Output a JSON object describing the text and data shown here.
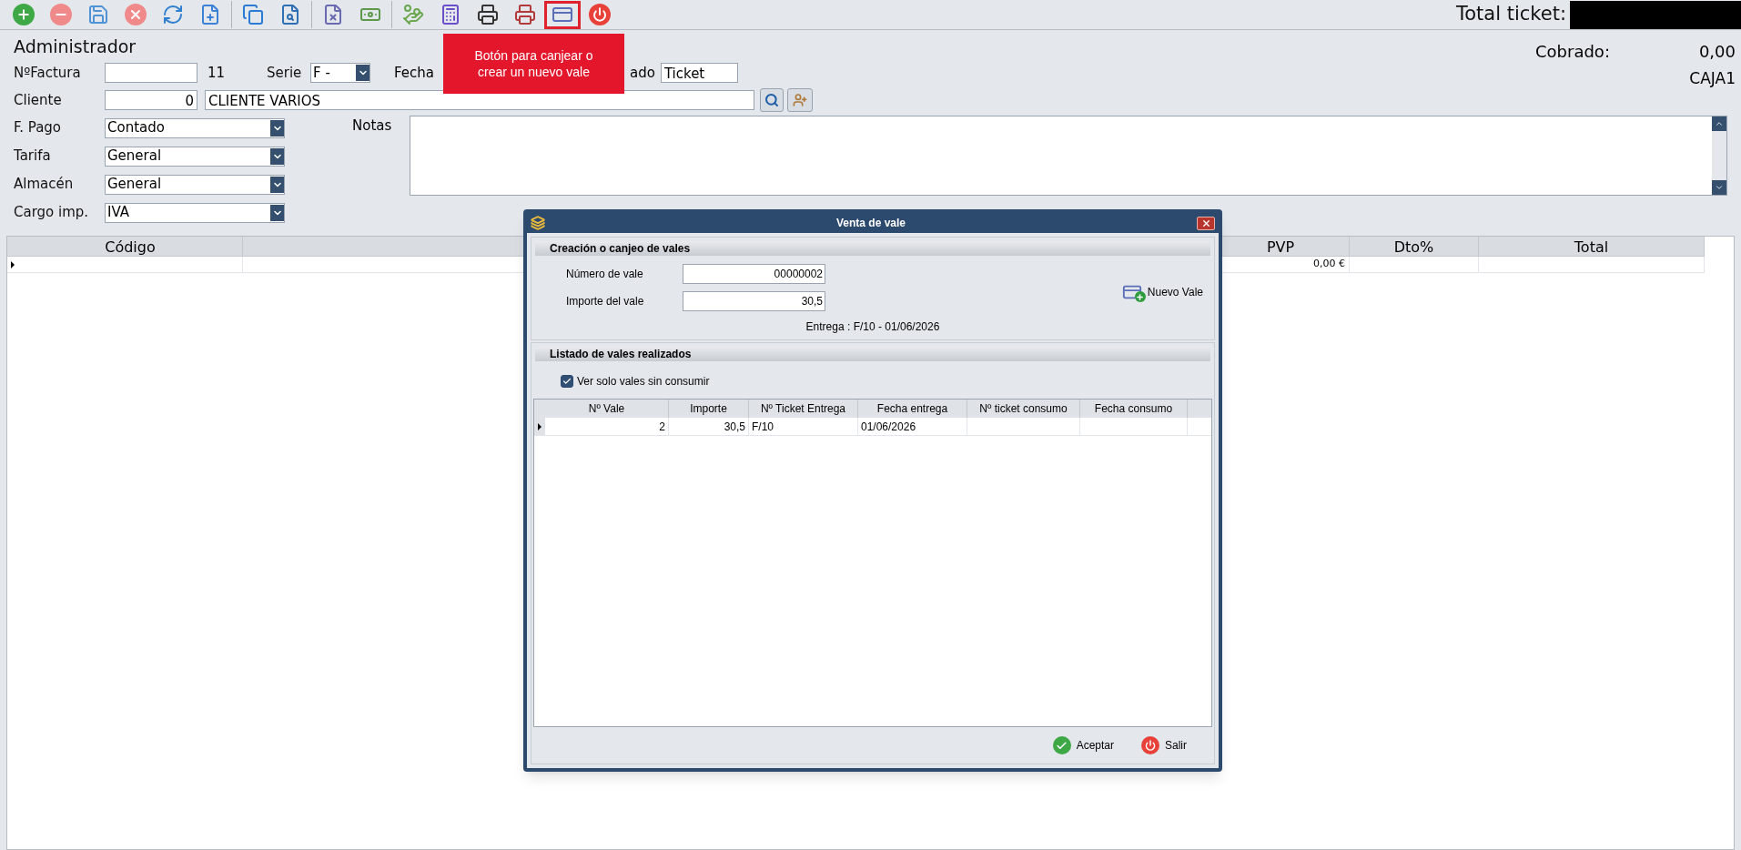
{
  "toolbar": {
    "buttons": [
      {
        "kind": "add",
        "selected": false
      },
      {
        "kind": "remove",
        "selected": false
      },
      {
        "kind": "save",
        "selected": false
      },
      {
        "kind": "cancel",
        "selected": false
      },
      {
        "kind": "refresh",
        "selected": false
      },
      {
        "kind": "new-document",
        "selected": false
      },
      {
        "kind": "copy",
        "selected": false
      },
      {
        "kind": "find-document",
        "selected": false
      },
      {
        "kind": "void-document",
        "selected": false
      },
      {
        "kind": "cash",
        "selected": false
      },
      {
        "kind": "payment",
        "selected": false
      },
      {
        "kind": "register",
        "selected": false
      },
      {
        "kind": "print",
        "selected": false
      },
      {
        "kind": "print-alt",
        "selected": false
      },
      {
        "kind": "voucher",
        "selected": true
      },
      {
        "kind": "power",
        "selected": false
      }
    ]
  },
  "header": {
    "user": "Administrador",
    "total_label": "Total ticket:",
    "cobrado_label": "Cobrado:",
    "cobrado_value": "0,00",
    "caja": "CAJA1"
  },
  "tooltip": "Botón para canjear o crear un nuevo vale",
  "form": {
    "factura_label": "NºFactura",
    "factura_number": "11",
    "serie_label": "Serie",
    "serie_value": "F   -",
    "fecha_label": "Fecha",
    "estado_label": "ado",
    "estado_value": "Ticket",
    "cliente_label": "Cliente",
    "cliente_code": "0",
    "cliente_name": "CLIENTE VARIOS",
    "notas_label": "Notas",
    "selects": [
      {
        "label": "F. Pago",
        "value": "Contado"
      },
      {
        "label": "Tarifa",
        "value": "General"
      },
      {
        "label": "Almacén",
        "value": "General"
      },
      {
        "label": "Cargo imp.",
        "value": "IVA"
      }
    ]
  },
  "table": {
    "columns": [
      {
        "label": "Código"
      },
      {
        "label": "PVP"
      },
      {
        "label": "Dto%"
      },
      {
        "label": "Total"
      }
    ],
    "rows": [
      {
        "current": true,
        "pvp": "0,00 €"
      }
    ]
  },
  "dialog": {
    "title": "Venta de vale",
    "section_1": "Creación o canjeo de vales",
    "fields": [
      {
        "label": "Número de vale",
        "value": "00000002"
      },
      {
        "label": "Importe del vale",
        "value": "30,5"
      }
    ],
    "new_button": "Nuevo Vale",
    "delivery": "Entrega : F/10 - 01/06/2026",
    "section_2": "Listado de vales realizados",
    "checkbox": {
      "label": "Ver solo vales sin consumir",
      "checked": true
    },
    "grid": {
      "columns": [
        {
          "label": "Nº Vale"
        },
        {
          "label": "Importe"
        },
        {
          "label": "Nº Ticket Entrega"
        },
        {
          "label": "Fecha entrega"
        },
        {
          "label": "Nº ticket consumo"
        },
        {
          "label": "Fecha consumo"
        }
      ],
      "rows": [
        {
          "current": true,
          "cells": [
            "2",
            "30,5",
            "F/10",
            "01/06/2026"
          ]
        }
      ]
    },
    "buttons": [
      {
        "kind": "accept",
        "label": "Aceptar"
      },
      {
        "kind": "exit",
        "label": "Salir"
      }
    ]
  }
}
